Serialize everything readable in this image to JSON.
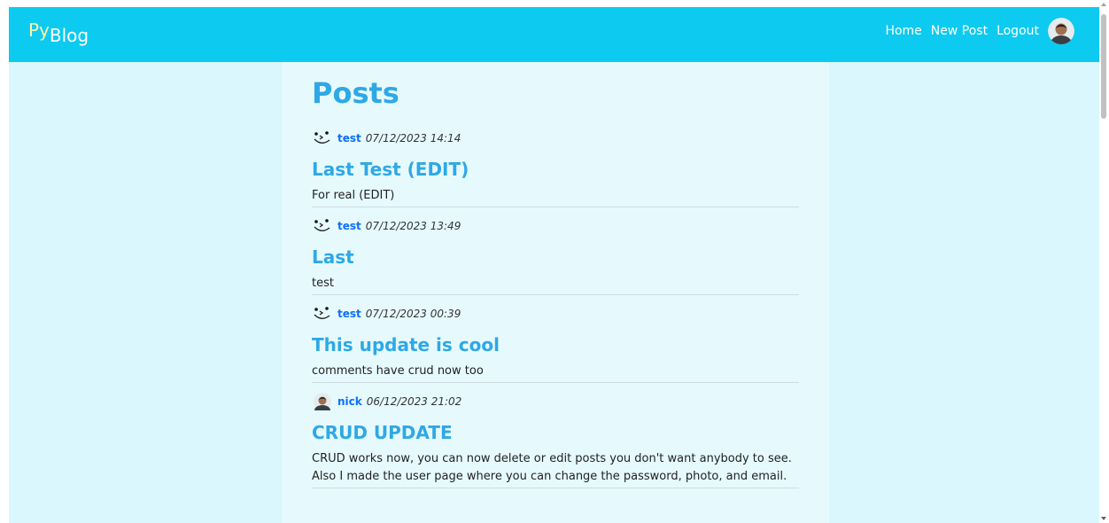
{
  "navbar": {
    "brand": {
      "part1": "Py",
      "part2": "Blog"
    },
    "links": [
      "Home",
      "New Post",
      "Logout"
    ],
    "colors": {
      "background": "#0dcaf0",
      "brand_accent": "#fff6a8"
    }
  },
  "main": {
    "title": "Posts",
    "posts": [
      {
        "author": "test",
        "date": "07/12/2023 14:14",
        "title": "Last Test (EDIT)",
        "body": "For real (EDIT)",
        "avatar": "smiley-face-icon"
      },
      {
        "author": "test",
        "date": "07/12/2023 13:49",
        "title": "Last",
        "body": "test",
        "avatar": "smiley-face-icon"
      },
      {
        "author": "test",
        "date": "07/12/2023 00:39",
        "title": "This update is cool",
        "body": "comments have crud now too",
        "avatar": "smiley-face-icon"
      },
      {
        "author": "nick",
        "date": "06/12/2023 21:02",
        "title": "CRUD UPDATE",
        "body": "CRUD works now, you can now delete or edit posts you don't want anybody to see. Also I made the user page where you can change the password, photo, and email.",
        "avatar": "user-photo-avatar"
      }
    ]
  },
  "colors": {
    "page_bg": "#d9f7fc",
    "content_bg": "#e6fafd",
    "title": "#2ea8e6",
    "author": "#0d6efd"
  }
}
